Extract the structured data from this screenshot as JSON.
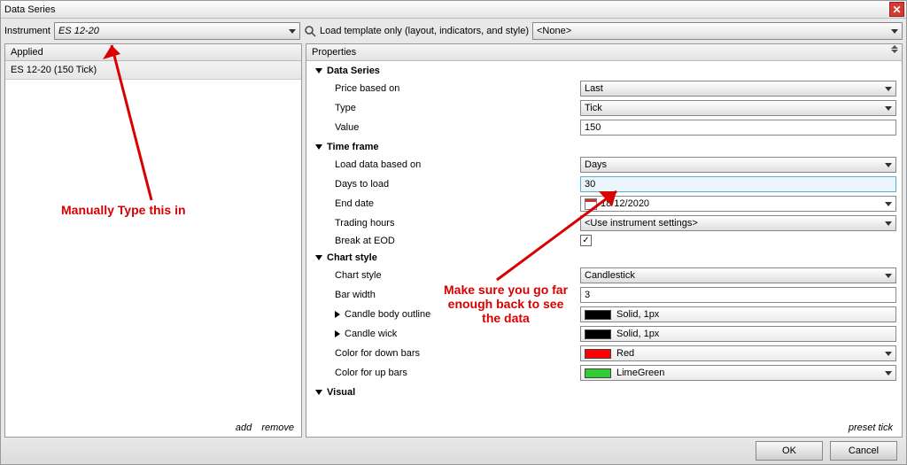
{
  "window": {
    "title": "Data Series"
  },
  "topbar": {
    "instrument_label": "Instrument",
    "instrument_value": "ES 12-20",
    "load_template_label": "Load template only (layout, indicators, and style)",
    "template_value": "<None>"
  },
  "left": {
    "header": "Applied",
    "items": [
      "ES 12-20 (150 Tick)"
    ],
    "footer": {
      "add": "add",
      "remove": "remove"
    }
  },
  "right": {
    "header": "Properties",
    "footer": "preset tick",
    "groups": {
      "data_series": {
        "title": "Data Series",
        "price_based_on": {
          "label": "Price based on",
          "value": "Last"
        },
        "type": {
          "label": "Type",
          "value": "Tick"
        },
        "value": {
          "label": "Value",
          "value": "150"
        }
      },
      "time_frame": {
        "title": "Time frame",
        "load_data": {
          "label": "Load data based on",
          "value": "Days"
        },
        "days_to_load": {
          "label": "Days to load",
          "value": "30"
        },
        "end_date": {
          "label": "End date",
          "value": "18/12/2020"
        },
        "trading_hours": {
          "label": "Trading hours",
          "value": "<Use instrument settings>"
        },
        "break_eod": {
          "label": "Break at EOD",
          "checked": true
        }
      },
      "chart_style": {
        "title": "Chart style",
        "chart_style": {
          "label": "Chart style",
          "value": "Candlestick"
        },
        "bar_width": {
          "label": "Bar width",
          "value": "3"
        },
        "candle_body": {
          "label": "Candle body outline",
          "value": "Solid, 1px",
          "color": "#000000"
        },
        "candle_wick": {
          "label": "Candle wick",
          "value": "Solid, 1px",
          "color": "#000000"
        },
        "color_down": {
          "label": "Color for down bars",
          "value": "Red",
          "color": "#ff0000"
        },
        "color_up": {
          "label": "Color for up bars",
          "value": "LimeGreen",
          "color": "#32cd32"
        }
      },
      "visual": {
        "title": "Visual"
      }
    }
  },
  "annotations": {
    "top": "Manually Type this in",
    "middle": "Make sure you go far\nenough back to see\nthe data"
  },
  "buttons": {
    "ok": "OK",
    "cancel": "Cancel"
  }
}
